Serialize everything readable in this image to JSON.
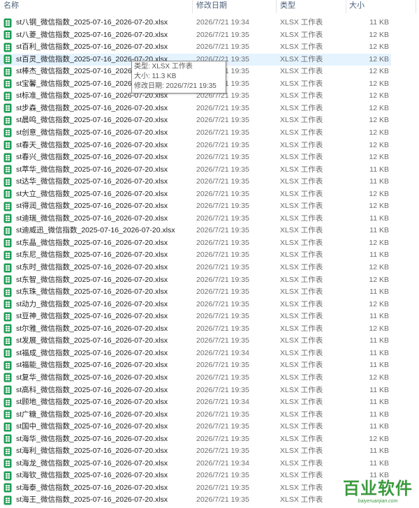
{
  "columns": {
    "name": "名称",
    "date": "修改日期",
    "type": "类型",
    "size": "大小"
  },
  "icons": {
    "file": "excel-file-icon"
  },
  "colors": {
    "hover_row": "#e5f3ff",
    "icon_green": "#1f9d55",
    "watermark": "#3b9a3f",
    "header_text": "#4c607a"
  },
  "files": [
    {
      "name": "st八钢_微信指数_2025-07-16_2026-07-20.xlsx",
      "date": "2026/7/21 19:34",
      "type": "XLSX 工作表",
      "size": "11 KB"
    },
    {
      "name": "st八菱_微信指数_2025-07-16_2026-07-20.xlsx",
      "date": "2026/7/21 19:35",
      "type": "XLSX 工作表",
      "size": "12 KB"
    },
    {
      "name": "st百利_微信指数_2025-07-16_2026-07-20.xlsx",
      "date": "2026/7/21 19:35",
      "type": "XLSX 工作表",
      "size": "12 KB"
    },
    {
      "name": "st百灵_微信指数_2025-07-16_2026-07-20.xlsx",
      "date": "2026/7/21 19:35",
      "type": "XLSX 工作表",
      "size": "12 KB",
      "hovered": true
    },
    {
      "name": "st棒杰_微信指数_2025-07-16_2026-07-20.xlsx",
      "date": "2026/7/21 19:35",
      "type": "XLSX 工作表",
      "size": "12 KB"
    },
    {
      "name": "st宝馨_微信指数_2025-07-16_2026-07-20.xlsx",
      "date": "2026/7/21 19:35",
      "type": "XLSX 工作表",
      "size": "12 KB"
    },
    {
      "name": "st标准_微信指数_2025-07-16_2026-07-20.xlsx",
      "date": "2026/7/21 19:35",
      "type": "XLSX 工作表",
      "size": "12 KB"
    },
    {
      "name": "st步森_微信指数_2025-07-16_2026-07-20.xlsx",
      "date": "2026/7/21 19:35",
      "type": "XLSX 工作表",
      "size": "12 KB"
    },
    {
      "name": "st晨鸣_微信指数_2025-07-16_2026-07-20.xlsx",
      "date": "2026/7/21 19:35",
      "type": "XLSX 工作表",
      "size": "12 KB"
    },
    {
      "name": "st创意_微信指数_2025-07-16_2026-07-20.xlsx",
      "date": "2026/7/21 19:35",
      "type": "XLSX 工作表",
      "size": "12 KB"
    },
    {
      "name": "st春天_微信指数_2025-07-16_2026-07-20.xlsx",
      "date": "2026/7/21 19:35",
      "type": "XLSX 工作表",
      "size": "12 KB"
    },
    {
      "name": "st春兴_微信指数_2025-07-16_2026-07-20.xlsx",
      "date": "2026/7/21 19:35",
      "type": "XLSX 工作表",
      "size": "12 KB"
    },
    {
      "name": "st萃华_微信指数_2025-07-16_2026-07-20.xlsx",
      "date": "2026/7/21 19:35",
      "type": "XLSX 工作表",
      "size": "11 KB"
    },
    {
      "name": "st达华_微信指数_2025-07-16_2026-07-20.xlsx",
      "date": "2026/7/21 19:35",
      "type": "XLSX 工作表",
      "size": "11 KB"
    },
    {
      "name": "st大立_微信指数_2025-07-16_2026-07-20.xlsx",
      "date": "2026/7/21 19:35",
      "type": "XLSX 工作表",
      "size": "12 KB"
    },
    {
      "name": "st得润_微信指数_2025-07-16_2026-07-20.xlsx",
      "date": "2026/7/21 19:35",
      "type": "XLSX 工作表",
      "size": "12 KB"
    },
    {
      "name": "st迪瑞_微信指数_2025-07-16_2026-07-20.xlsx",
      "date": "2026/7/21 19:35",
      "type": "XLSX 工作表",
      "size": "11 KB"
    },
    {
      "name": "st迪威迅_微信指数_2025-07-16_2026-07-20.xlsx",
      "date": "2026/7/21 19:35",
      "type": "XLSX 工作表",
      "size": "11 KB"
    },
    {
      "name": "st东晶_微信指数_2025-07-16_2026-07-20.xlsx",
      "date": "2026/7/21 19:35",
      "type": "XLSX 工作表",
      "size": "12 KB"
    },
    {
      "name": "st东尼_微信指数_2025-07-16_2026-07-20.xlsx",
      "date": "2026/7/21 19:35",
      "type": "XLSX 工作表",
      "size": "11 KB"
    },
    {
      "name": "st东时_微信指数_2025-07-16_2026-07-20.xlsx",
      "date": "2026/7/21 19:35",
      "type": "XLSX 工作表",
      "size": "12 KB"
    },
    {
      "name": "st东智_微信指数_2025-07-16_2026-07-20.xlsx",
      "date": "2026/7/21 19:35",
      "type": "XLSX 工作表",
      "size": "12 KB"
    },
    {
      "name": "st东珠_微信指数_2025-07-16_2026-07-20.xlsx",
      "date": "2026/7/21 19:35",
      "type": "XLSX 工作表",
      "size": "11 KB"
    },
    {
      "name": "st动力_微信指数_2025-07-16_2026-07-20.xlsx",
      "date": "2026/7/21 19:35",
      "type": "XLSX 工作表",
      "size": "12 KB"
    },
    {
      "name": "st豆神_微信指数_2025-07-16_2026-07-20.xlsx",
      "date": "2026/7/21 19:35",
      "type": "XLSX 工作表",
      "size": "11 KB"
    },
    {
      "name": "st尔雅_微信指数_2025-07-16_2026-07-20.xlsx",
      "date": "2026/7/21 19:35",
      "type": "XLSX 工作表",
      "size": "12 KB"
    },
    {
      "name": "st发展_微信指数_2025-07-16_2026-07-20.xlsx",
      "date": "2026/7/21 19:35",
      "type": "XLSX 工作表",
      "size": "11 KB"
    },
    {
      "name": "st福成_微信指数_2025-07-16_2026-07-20.xlsx",
      "date": "2026/7/21 19:34",
      "type": "XLSX 工作表",
      "size": "11 KB"
    },
    {
      "name": "st福能_微信指数_2025-07-16_2026-07-20.xlsx",
      "date": "2026/7/21 19:35",
      "type": "XLSX 工作表",
      "size": "11 KB"
    },
    {
      "name": "st复华_微信指数_2025-07-16_2026-07-20.xlsx",
      "date": "2026/7/21 19:35",
      "type": "XLSX 工作表",
      "size": "12 KB"
    },
    {
      "name": "st高科_微信指数_2025-07-16_2026-07-20.xlsx",
      "date": "2026/7/21 19:35",
      "type": "XLSX 工作表",
      "size": "11 KB"
    },
    {
      "name": "st顾地_微信指数_2025-07-16_2026-07-20.xlsx",
      "date": "2026/7/21 19:34",
      "type": "XLSX 工作表",
      "size": "11 KB"
    },
    {
      "name": "st广糖_微信指数_2025-07-16_2026-07-20.xlsx",
      "date": "2026/7/21 19:35",
      "type": "XLSX 工作表",
      "size": "11 KB"
    },
    {
      "name": "st国中_微信指数_2025-07-16_2026-07-20.xlsx",
      "date": "2026/7/21 19:35",
      "type": "XLSX 工作表",
      "size": "11 KB"
    },
    {
      "name": "st海华_微信指数_2025-07-16_2026-07-20.xlsx",
      "date": "2026/7/21 19:35",
      "type": "XLSX 工作表",
      "size": "12 KB"
    },
    {
      "name": "st海利_微信指数_2025-07-16_2026-07-20.xlsx",
      "date": "2026/7/21 19:35",
      "type": "XLSX 工作表",
      "size": "11 KB"
    },
    {
      "name": "st海龙_微信指数_2025-07-16_2026-07-20.xlsx",
      "date": "2026/7/21 19:34",
      "type": "XLSX 工作表",
      "size": "11 KB"
    },
    {
      "name": "st海钦_微信指数_2025-07-16_2026-07-20.xlsx",
      "date": "2026/7/21 19:35",
      "type": "XLSX 工作表",
      "size": "11 KB"
    },
    {
      "name": "st海泰_微信指数_2025-07-16_2026-07-20.xlsx",
      "date": "2026/7/21 19:35",
      "type": "XLSX 工作表",
      "size": ""
    },
    {
      "name": "st海王_微信指数_2025-07-16_2026-07-20.xlsx",
      "date": "2026/7/21 19:35",
      "type": "XLSX 工作表",
      "size": ""
    }
  ],
  "tooltip": {
    "type_line": "类型: XLSX 工作表",
    "size_line": "大小: 11.3 KB",
    "date_line": "修改日期: 2026/7/21 19:35"
  },
  "watermark": {
    "title": "百业软件",
    "url": "baiyeruanjian.com"
  }
}
